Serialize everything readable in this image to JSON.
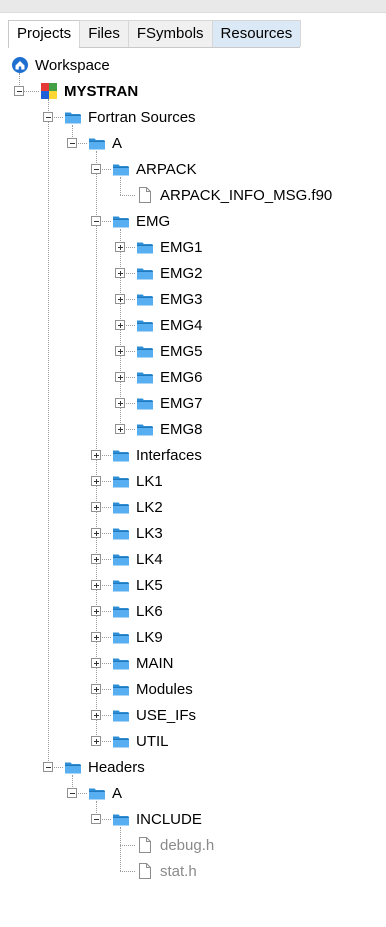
{
  "tabs": [
    {
      "label": "Projects",
      "active": true
    },
    {
      "label": "Files"
    },
    {
      "label": "FSymbols"
    },
    {
      "label": "Resources",
      "highlight": true
    }
  ],
  "tree": [
    {
      "label": "Workspace",
      "icon": "workspace-icon",
      "depth": 0
    },
    {
      "label": "MYSTRAN",
      "icon": "project-icon",
      "depth": 1,
      "bold": true,
      "expanded": true
    },
    {
      "label": "Fortran Sources",
      "icon": "folder-icon",
      "depth": 2,
      "expanded": true
    },
    {
      "label": "A",
      "icon": "folder-icon",
      "depth": 3,
      "expanded": true
    },
    {
      "label": "ARPACK",
      "icon": "folder-icon",
      "depth": 4,
      "expanded": true
    },
    {
      "label": "ARPACK_INFO_MSG.f90",
      "icon": "file-icon",
      "depth": 5
    },
    {
      "label": "EMG",
      "icon": "folder-icon",
      "depth": 4,
      "expanded": true
    },
    {
      "label": "EMG1",
      "icon": "folder-icon",
      "depth": 5,
      "expanded": false
    },
    {
      "label": "EMG2",
      "icon": "folder-icon",
      "depth": 5,
      "expanded": false
    },
    {
      "label": "EMG3",
      "icon": "folder-icon",
      "depth": 5,
      "expanded": false
    },
    {
      "label": "EMG4",
      "icon": "folder-icon",
      "depth": 5,
      "expanded": false
    },
    {
      "label": "EMG5",
      "icon": "folder-icon",
      "depth": 5,
      "expanded": false
    },
    {
      "label": "EMG6",
      "icon": "folder-icon",
      "depth": 5,
      "expanded": false
    },
    {
      "label": "EMG7",
      "icon": "folder-icon",
      "depth": 5,
      "expanded": false
    },
    {
      "label": "EMG8",
      "icon": "folder-icon",
      "depth": 5,
      "expanded": false
    },
    {
      "label": "Interfaces",
      "icon": "folder-icon",
      "depth": 4,
      "expanded": false
    },
    {
      "label": "LK1",
      "icon": "folder-icon",
      "depth": 4,
      "expanded": false
    },
    {
      "label": "LK2",
      "icon": "folder-icon",
      "depth": 4,
      "expanded": false
    },
    {
      "label": "LK3",
      "icon": "folder-icon",
      "depth": 4,
      "expanded": false
    },
    {
      "label": "LK4",
      "icon": "folder-icon",
      "depth": 4,
      "expanded": false
    },
    {
      "label": "LK5",
      "icon": "folder-icon",
      "depth": 4,
      "expanded": false
    },
    {
      "label": "LK6",
      "icon": "folder-icon",
      "depth": 4,
      "expanded": false
    },
    {
      "label": "LK9",
      "icon": "folder-icon",
      "depth": 4,
      "expanded": false
    },
    {
      "label": "MAIN",
      "icon": "folder-icon",
      "depth": 4,
      "expanded": false
    },
    {
      "label": "Modules",
      "icon": "folder-icon",
      "depth": 4,
      "expanded": false
    },
    {
      "label": "USE_IFs",
      "icon": "folder-icon",
      "depth": 4,
      "expanded": false
    },
    {
      "label": "UTIL",
      "icon": "folder-icon",
      "depth": 4,
      "expanded": false
    },
    {
      "label": "Headers",
      "icon": "folder-icon",
      "depth": 2,
      "expanded": true
    },
    {
      "label": "A",
      "icon": "folder-icon",
      "depth": 3,
      "expanded": true
    },
    {
      "label": "INCLUDE",
      "icon": "folder-icon",
      "depth": 4,
      "expanded": true
    },
    {
      "label": "debug.h",
      "icon": "file-icon",
      "depth": 5,
      "muted": true
    },
    {
      "label": "stat.h",
      "icon": "file-icon",
      "depth": 5,
      "muted": true
    }
  ]
}
